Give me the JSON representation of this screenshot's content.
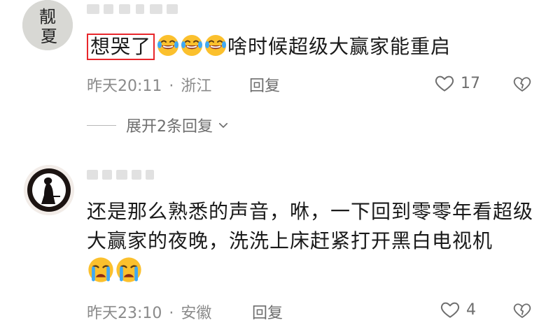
{
  "comments": [
    {
      "avatar_text": [
        "靓",
        "夏"
      ],
      "highlight_text": "想哭了",
      "emoji_count": 3,
      "emoji_name": "laugh-cry-emoji",
      "text": "啥时候超级大赢家能重启",
      "time": "昨天20:11",
      "separator": "·",
      "location": "浙江",
      "reply_label": "回复",
      "likes": "17",
      "expand_label": "展开2条回复"
    },
    {
      "avatar_name": "silhouette-avatar",
      "text": "还是那么熟悉的声音，咻，一下回到零零年看超级大赢家的夜晚，洗洗上床赶紧打开黑白电视机",
      "emoji_count": 2,
      "emoji_name": "crying-emoji",
      "time": "昨天23:10",
      "separator": "·",
      "location": "安徽",
      "reply_label": "回复",
      "likes": "4"
    }
  ],
  "colors": {
    "highlight_border": "#e8262b",
    "meta_text": "#8a8a8a",
    "emoji_face": "#fbc02d"
  }
}
